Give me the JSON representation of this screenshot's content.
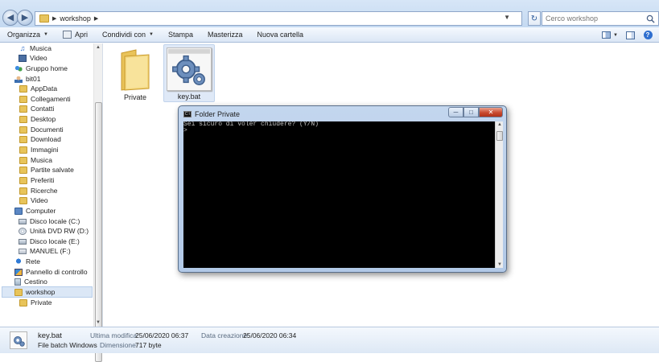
{
  "address": {
    "crumbs": [
      "workshop"
    ],
    "search_placeholder": "Cerco workshop"
  },
  "toolbar": {
    "organize": "Organizza",
    "open": "Apri",
    "share": "Condividi con",
    "print": "Stampa",
    "burn": "Masterizza",
    "new_folder": "Nuova cartella"
  },
  "nav": {
    "items": [
      {
        "label": "Musica",
        "icon": "music-icon"
      },
      {
        "label": "Video",
        "icon": "video-icon"
      },
      {
        "label": "Gruppo home",
        "icon": "homegroup-icon"
      },
      {
        "label": "bit01",
        "icon": "user-icon"
      },
      {
        "label": "AppData",
        "icon": "folder-icon"
      },
      {
        "label": "Collegamenti",
        "icon": "folder-icon"
      },
      {
        "label": "Contatti",
        "icon": "folder-icon"
      },
      {
        "label": "Desktop",
        "icon": "folder-icon"
      },
      {
        "label": "Documenti",
        "icon": "folder-icon"
      },
      {
        "label": "Download",
        "icon": "folder-icon"
      },
      {
        "label": "Immagini",
        "icon": "folder-icon"
      },
      {
        "label": "Musica",
        "icon": "folder-icon"
      },
      {
        "label": "Partite salvate",
        "icon": "folder-icon"
      },
      {
        "label": "Preferiti",
        "icon": "folder-icon"
      },
      {
        "label": "Ricerche",
        "icon": "folder-icon"
      },
      {
        "label": "Video",
        "icon": "folder-icon"
      },
      {
        "label": "Computer",
        "icon": "computer-icon"
      },
      {
        "label": "Disco locale (C:)",
        "icon": "drive-icon"
      },
      {
        "label": "Unità DVD RW (D:)",
        "icon": "dvd-icon"
      },
      {
        "label": "Disco locale (E:)",
        "icon": "drive-icon"
      },
      {
        "label": "MANUEL (F:)",
        "icon": "usb-drive-icon"
      },
      {
        "label": "Rete",
        "icon": "network-icon"
      },
      {
        "label": "Pannello di controllo",
        "icon": "control-panel-icon"
      },
      {
        "label": "Cestino",
        "icon": "recycle-bin-icon"
      },
      {
        "label": "workshop",
        "icon": "folder-icon"
      },
      {
        "label": "Private",
        "icon": "folder-icon"
      }
    ]
  },
  "content": {
    "files": [
      {
        "name": "Private",
        "icon": "folder-icon"
      },
      {
        "name": "key.bat",
        "icon": "batch-file-icon"
      }
    ]
  },
  "console": {
    "title": "Folder Private",
    "lines": [
      "Sei sicuro di voler chiudere? (Y/N)",
      ">"
    ]
  },
  "details": {
    "name": "key.bat",
    "type": "File batch Windows",
    "modified_label": "Ultima modifica:",
    "modified_value": "25/06/2020 06:37",
    "created_label": "Data creazione:",
    "created_value": "25/06/2020 06:34",
    "size_label": "Dimensione:",
    "size_value": "717 byte"
  }
}
